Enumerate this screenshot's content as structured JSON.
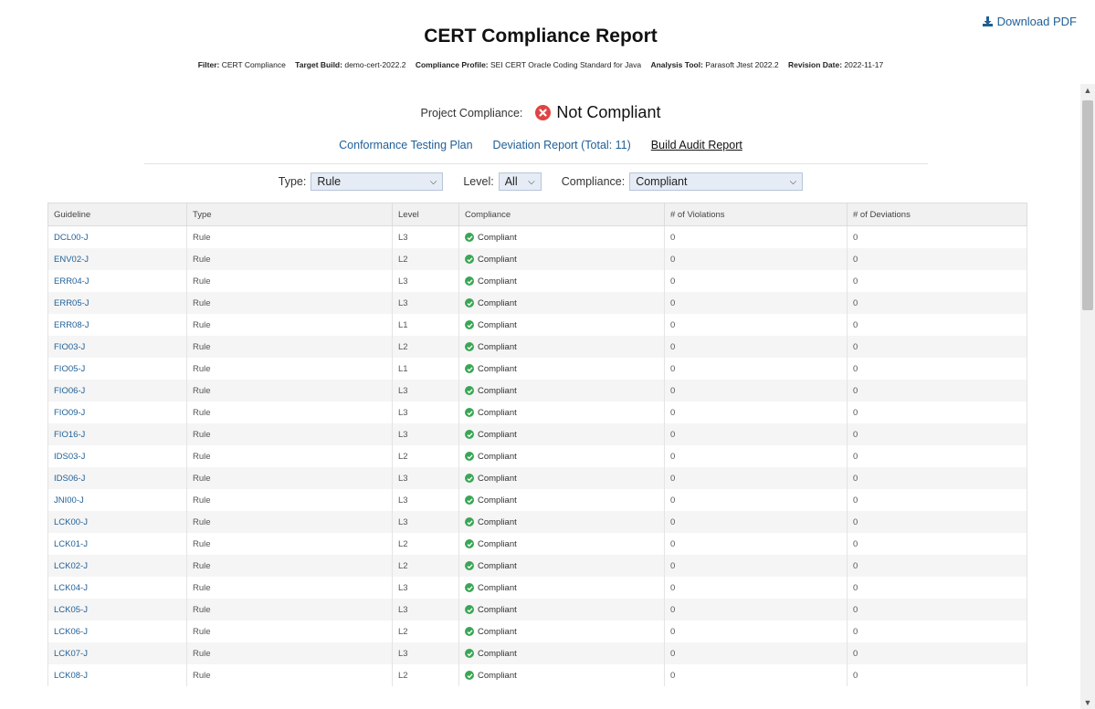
{
  "download_label": "Download PDF",
  "title": "CERT Compliance Report",
  "meta": {
    "filter_label": "Filter:",
    "filter_value": "CERT Compliance",
    "build_label": "Target Build:",
    "build_value": "demo-cert-2022.2",
    "profile_label": "Compliance Profile:",
    "profile_value": "SEI CERT Oracle Coding Standard for Java",
    "tool_label": "Analysis Tool:",
    "tool_value": "Parasoft Jtest 2022.2",
    "date_label": "Revision Date:",
    "date_value": "2022-11-17"
  },
  "project": {
    "label": "Project Compliance:",
    "status": "Not Compliant",
    "status_color": "#e04343"
  },
  "links": {
    "plan": "Conformance Testing Plan",
    "deviation": "Deviation Report (Total: 11)",
    "audit": "Build Audit Report"
  },
  "filters": {
    "type_label": "Type:",
    "type_value": "Rule",
    "level_label": "Level:",
    "level_value": "All",
    "compliance_label": "Compliance:",
    "compliance_value": "Compliant"
  },
  "table": {
    "headers": [
      "Guideline",
      "Type",
      "Level",
      "Compliance",
      "# of Violations",
      "# of Deviations"
    ],
    "rows": [
      [
        "DCL00-J",
        "Rule",
        "L3",
        "Compliant",
        "0",
        "0"
      ],
      [
        "ENV02-J",
        "Rule",
        "L2",
        "Compliant",
        "0",
        "0"
      ],
      [
        "ERR04-J",
        "Rule",
        "L3",
        "Compliant",
        "0",
        "0"
      ],
      [
        "ERR05-J",
        "Rule",
        "L3",
        "Compliant",
        "0",
        "0"
      ],
      [
        "ERR08-J",
        "Rule",
        "L1",
        "Compliant",
        "0",
        "0"
      ],
      [
        "FIO03-J",
        "Rule",
        "L2",
        "Compliant",
        "0",
        "0"
      ],
      [
        "FIO05-J",
        "Rule",
        "L1",
        "Compliant",
        "0",
        "0"
      ],
      [
        "FIO06-J",
        "Rule",
        "L3",
        "Compliant",
        "0",
        "0"
      ],
      [
        "FIO09-J",
        "Rule",
        "L3",
        "Compliant",
        "0",
        "0"
      ],
      [
        "FIO16-J",
        "Rule",
        "L3",
        "Compliant",
        "0",
        "0"
      ],
      [
        "IDS03-J",
        "Rule",
        "L2",
        "Compliant",
        "0",
        "0"
      ],
      [
        "IDS06-J",
        "Rule",
        "L3",
        "Compliant",
        "0",
        "0"
      ],
      [
        "JNI00-J",
        "Rule",
        "L3",
        "Compliant",
        "0",
        "0"
      ],
      [
        "LCK00-J",
        "Rule",
        "L3",
        "Compliant",
        "0",
        "0"
      ],
      [
        "LCK01-J",
        "Rule",
        "L2",
        "Compliant",
        "0",
        "0"
      ],
      [
        "LCK02-J",
        "Rule",
        "L2",
        "Compliant",
        "0",
        "0"
      ],
      [
        "LCK04-J",
        "Rule",
        "L3",
        "Compliant",
        "0",
        "0"
      ],
      [
        "LCK05-J",
        "Rule",
        "L3",
        "Compliant",
        "0",
        "0"
      ],
      [
        "LCK06-J",
        "Rule",
        "L2",
        "Compliant",
        "0",
        "0"
      ],
      [
        "LCK07-J",
        "Rule",
        "L3",
        "Compliant",
        "0",
        "0"
      ],
      [
        "LCK08-J",
        "Rule",
        "L2",
        "Compliant",
        "0",
        "0"
      ]
    ]
  }
}
